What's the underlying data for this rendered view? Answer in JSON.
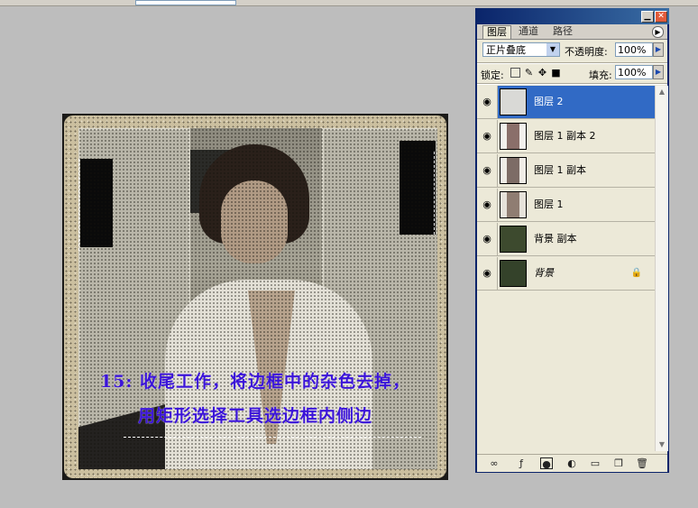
{
  "canvas": {
    "caption_line1": "15: 收尾工作，将边框中的杂色去掉，",
    "caption_line2": "用矩形选择工具选边框内侧边"
  },
  "layers_panel": {
    "tabs": [
      "图层",
      "通道",
      "路径"
    ],
    "active_tab": "图层",
    "blend_mode": "正片叠底",
    "opacity_label": "不透明度:",
    "opacity_value": "100%",
    "lock_label": "锁定:",
    "fill_label": "填充:",
    "fill_value": "100%",
    "layers": [
      {
        "name": "图层 2",
        "selected": true,
        "thumb_color": "#d9d9d6"
      },
      {
        "name": "图层 1 副本 2",
        "selected": false,
        "thumb_color": "#8a6f6a"
      },
      {
        "name": "图层 1 副本",
        "selected": false,
        "thumb_color": "#7d6c66"
      },
      {
        "name": "图层 1",
        "selected": false,
        "thumb_color": "#8f7d72"
      },
      {
        "name": "背景 副本",
        "selected": false,
        "thumb_color": "#3d4a2e"
      },
      {
        "name": "背景",
        "selected": false,
        "thumb_color": "#34422a",
        "locked": true
      }
    ]
  },
  "colors": {
    "caption": "#3b14d8",
    "selection": "#316ac5",
    "panel_title": "#0a246a"
  }
}
